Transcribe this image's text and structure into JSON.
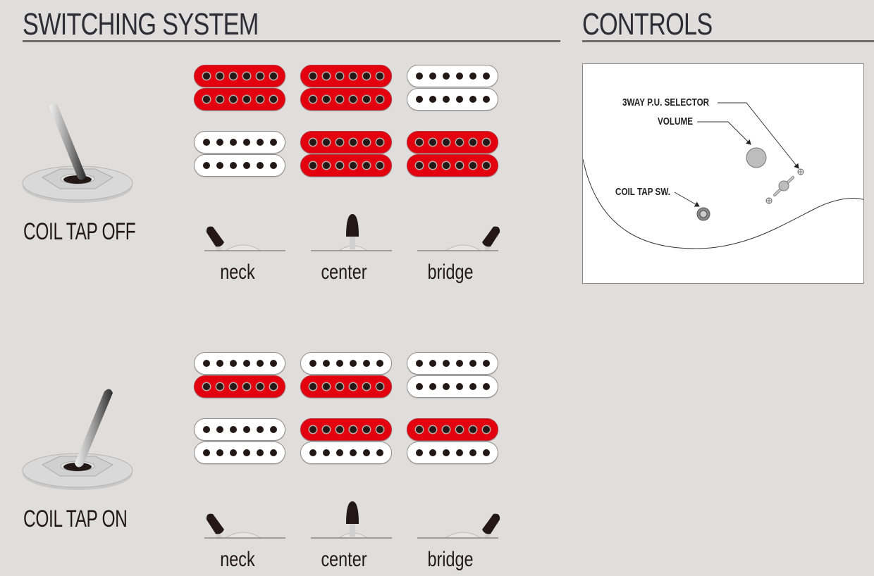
{
  "switching_system": {
    "title": "SWITCHING SYSTEM",
    "pickup_colors": {
      "active": "#e3000f",
      "inactive": "#ffffff"
    },
    "states": [
      {
        "label": "COIL TAP OFF",
        "toggle_position": "back",
        "positions": [
          {
            "label": "neck",
            "selector": "left",
            "neck_pickup": [
              "active",
              "active"
            ],
            "bridge_pickup": [
              "inactive",
              "inactive"
            ]
          },
          {
            "label": "center",
            "selector": "center",
            "neck_pickup": [
              "active",
              "active"
            ],
            "bridge_pickup": [
              "active",
              "active"
            ]
          },
          {
            "label": "bridge",
            "selector": "right",
            "neck_pickup": [
              "inactive",
              "inactive"
            ],
            "bridge_pickup": [
              "active",
              "active"
            ]
          }
        ]
      },
      {
        "label": "COIL TAP ON",
        "toggle_position": "forward",
        "positions": [
          {
            "label": "neck",
            "selector": "left",
            "neck_pickup": [
              "inactive",
              "active"
            ],
            "bridge_pickup": [
              "inactive",
              "inactive"
            ]
          },
          {
            "label": "center",
            "selector": "center",
            "neck_pickup": [
              "inactive",
              "active"
            ],
            "bridge_pickup": [
              "active",
              "inactive"
            ]
          },
          {
            "label": "bridge",
            "selector": "right",
            "neck_pickup": [
              "inactive",
              "inactive"
            ],
            "bridge_pickup": [
              "active",
              "inactive"
            ]
          }
        ]
      }
    ]
  },
  "controls": {
    "title": "CONTROLS",
    "labels": {
      "selector": "3WAY P.U. SELECTOR",
      "volume": "VOLUME",
      "coil_tap": "COIL TAP SW."
    }
  }
}
